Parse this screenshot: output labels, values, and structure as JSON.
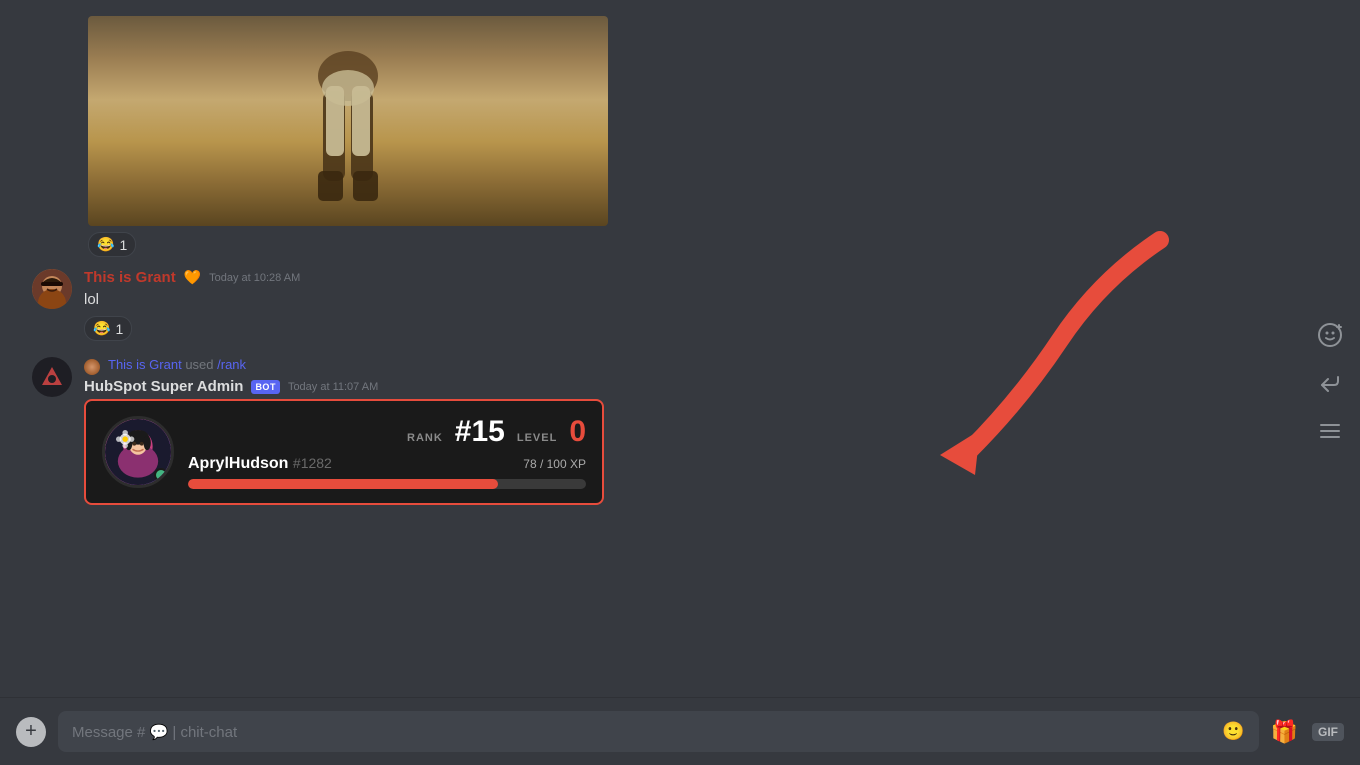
{
  "chat": {
    "background": "#36393f",
    "messages": [
      {
        "id": "img-message",
        "type": "image"
      },
      {
        "id": "grant-message",
        "type": "text",
        "username": "This is Grant",
        "heart": "🧡",
        "timestamp": "Today at 10:28 AM",
        "text": "lol",
        "reaction": "😂",
        "reaction_count": "1"
      },
      {
        "id": "hubspot-message",
        "type": "bot",
        "command_user": "This is Grant",
        "command": "/rank",
        "username": "HubSpot Super Admin",
        "bot_badge": "BOT",
        "timestamp": "Today at 11:07 AM"
      }
    ],
    "rank_card": {
      "rank_label": "RANK",
      "rank_number": "#15",
      "level_label": "LEVEL",
      "level_number": "0",
      "username": "AprylHudson",
      "discriminator": "#1282",
      "xp_current": "78",
      "xp_max": "100",
      "xp_label": "78 / 100 XP",
      "xp_percent": 78
    },
    "input": {
      "placeholder": "Message #",
      "channel": "chit-chat"
    },
    "toolbar": {
      "add_label": "+",
      "gif_label": "GIF"
    }
  }
}
